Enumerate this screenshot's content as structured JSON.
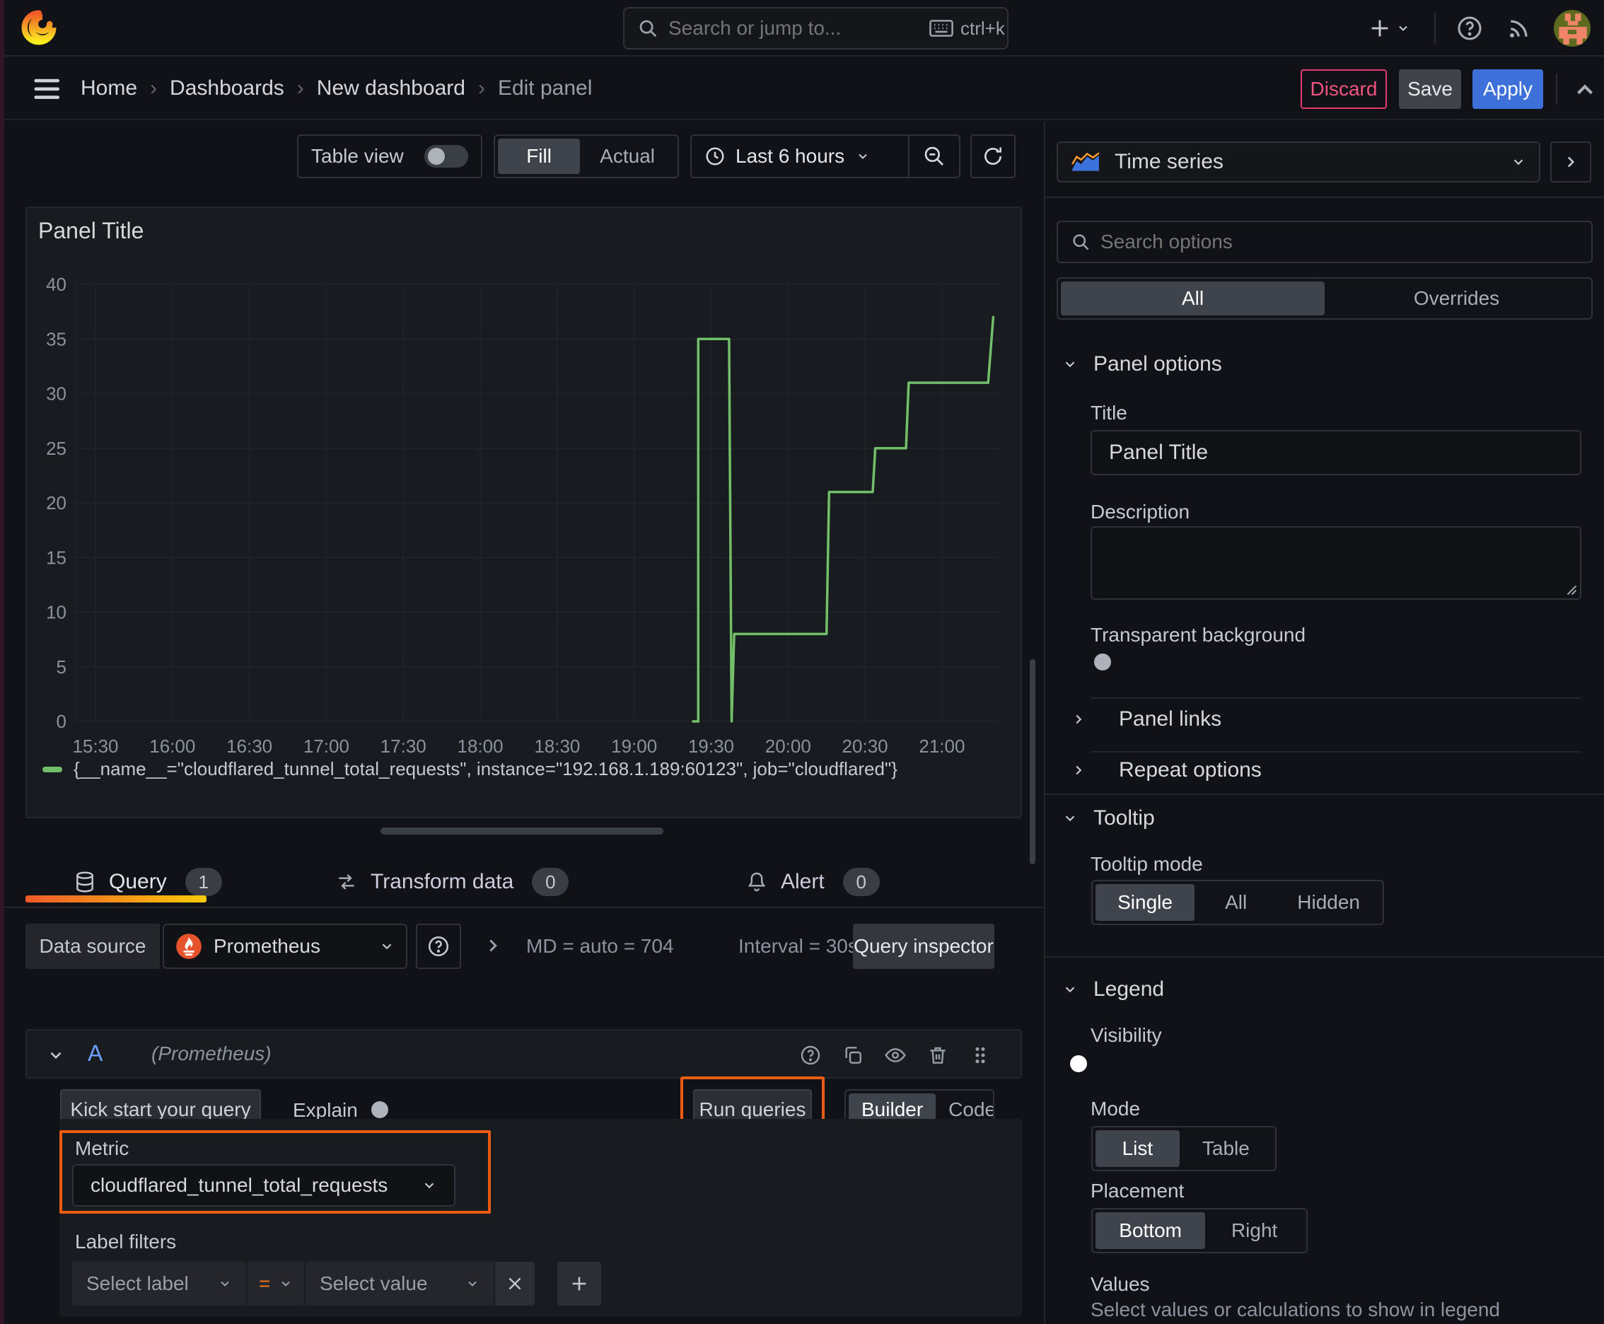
{
  "topbar": {
    "search_placeholder": "Search or jump to...",
    "shortcut": "ctrl+k"
  },
  "breadcrumb": {
    "items": [
      "Home",
      "Dashboards",
      "New dashboard",
      "Edit panel"
    ],
    "separator": "›"
  },
  "actions": {
    "discard": "Discard",
    "save": "Save",
    "apply": "Apply"
  },
  "toolbar": {
    "table_view": "Table view",
    "fill": "Fill",
    "actual": "Actual",
    "time_range": "Last 6 hours"
  },
  "tabs": {
    "query": "Query",
    "query_count": "1",
    "transform": "Transform data",
    "transform_count": "0",
    "alert": "Alert",
    "alert_count": "0"
  },
  "datasource": {
    "label": "Data source",
    "name": "Prometheus",
    "md": "MD = auto = 704",
    "interval": "Interval = 30s",
    "inspector": "Query inspector"
  },
  "query_row": {
    "ref": "A",
    "ds": "(Prometheus)"
  },
  "builder": {
    "kick_start": "Kick start your query",
    "explain": "Explain",
    "run_queries": "Run queries",
    "builder": "Builder",
    "code": "Code",
    "metric_label": "Metric",
    "metric_value": "cloudflared_tunnel_total_requests",
    "label_filters": "Label filters",
    "select_label": "Select label",
    "operator": "=",
    "select_value": "Select value"
  },
  "options": {
    "viz_type": "Time series",
    "search_placeholder": "Search options",
    "tab_all": "All",
    "tab_overrides": "Overrides",
    "panel_options": "Panel options",
    "title_label": "Title",
    "title_value": "Panel Title",
    "description_label": "Description",
    "transparent_background": "Transparent background",
    "panel_links": "Panel links",
    "repeat_options": "Repeat options",
    "tooltip": "Tooltip",
    "tooltip_mode": "Tooltip mode",
    "tooltip_single": "Single",
    "tooltip_all": "All",
    "tooltip_hidden": "Hidden",
    "legend": "Legend",
    "visibility": "Visibility",
    "mode": "Mode",
    "mode_list": "List",
    "mode_table": "Table",
    "placement": "Placement",
    "placement_bottom": "Bottom",
    "placement_right": "Right",
    "values": "Values",
    "values_hint": "Select values or calculations to show in legend"
  },
  "chart_data": {
    "type": "line",
    "line_style": "step",
    "title": "Panel Title",
    "xlabel": "",
    "ylabel": "",
    "ylim": [
      0,
      40
    ],
    "grid": true,
    "legend_position": "bottom",
    "x_ticks": [
      "15:30",
      "16:00",
      "16:30",
      "17:00",
      "17:30",
      "18:00",
      "18:30",
      "19:00",
      "19:30",
      "20:00",
      "20:30",
      "21:00"
    ],
    "y_ticks": [
      0,
      5,
      10,
      15,
      20,
      25,
      30,
      35,
      40
    ],
    "series": [
      {
        "name": "{__name__=\"cloudflared_tunnel_total_requests\", instance=\"192.168.1.189:60123\", job=\"cloudflared\"}",
        "color": "#73BF69",
        "points": [
          [
            "19:23",
            0
          ],
          [
            "19:25",
            0
          ],
          [
            "19:25",
            35
          ],
          [
            "19:37",
            35
          ],
          [
            "19:38",
            0
          ],
          [
            "19:39",
            8
          ],
          [
            "20:15",
            8
          ],
          [
            "20:16",
            21
          ],
          [
            "20:33",
            21
          ],
          [
            "20:34",
            25
          ],
          [
            "20:46",
            25
          ],
          [
            "20:47",
            31
          ],
          [
            "21:18",
            31
          ],
          [
            "21:20",
            37
          ]
        ]
      }
    ]
  },
  "colors": {
    "accent_blue": "#3D71D9",
    "highlight_orange": "#EB5B13",
    "series_green": "#73BF69",
    "destructive_pink": "#E5396F",
    "tab_underline_start": "#F05A28",
    "tab_underline_end": "#FBCA0A"
  }
}
